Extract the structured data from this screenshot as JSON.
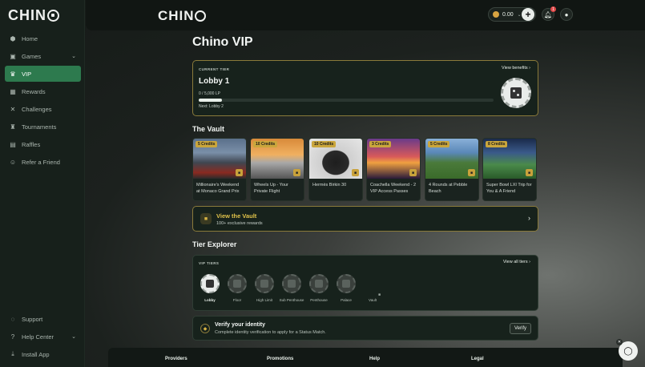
{
  "brand": {
    "logo": "CHINO"
  },
  "sidebar": {
    "items": [
      {
        "label": "Home",
        "icon": "home-icon"
      },
      {
        "label": "Games",
        "icon": "gamepad-icon"
      },
      {
        "label": "VIP",
        "icon": "crown-icon"
      },
      {
        "label": "Rewards",
        "icon": "gift-icon"
      },
      {
        "label": "Challenges",
        "icon": "swords-icon"
      },
      {
        "label": "Tournaments",
        "icon": "trophy-icon"
      },
      {
        "label": "Raffles",
        "icon": "ticket-icon"
      },
      {
        "label": "Refer a Friend",
        "icon": "user-plus-icon"
      }
    ],
    "bottom": [
      {
        "label": "Support",
        "icon": "chat-icon"
      },
      {
        "label": "Help Center",
        "icon": "question-icon"
      },
      {
        "label": "Install App",
        "icon": "download-icon"
      }
    ]
  },
  "topbar": {
    "balance": "0.00",
    "notifications": "1"
  },
  "page": {
    "title": "Chino VIP"
  },
  "current_tier": {
    "label": "CURRENT TIER",
    "name": "Lobby 1",
    "progress_text": "0 / 5,000 LP",
    "progress": 0.08,
    "next": "Next: Lobby 2",
    "benefits_link": "View benefits"
  },
  "vault": {
    "title": "The Vault",
    "items": [
      {
        "credits": "5 Credits",
        "title": "Millionaire's Weekend at Monaco Grand Prix"
      },
      {
        "credits": "10 Credits",
        "title": "Wheels Up - Your Private Flight"
      },
      {
        "credits": "10 Credits",
        "title": "Hermès Birkin 30"
      },
      {
        "credits": "3 Credits",
        "title": "Coachella Weekend - 2 VIP Access Passes"
      },
      {
        "credits": "5 Credits",
        "title": "4 Rounds at Pebble Beach"
      },
      {
        "credits": "8 Credits",
        "title": "Super Bowl LXI Trip for You & A Friend"
      }
    ],
    "cta_title": "View the Vault",
    "cta_sub": "100+ exclusive rewards"
  },
  "tiers": {
    "title": "Tier Explorer",
    "label": "VIP TIERS",
    "view_all": "View all tiers",
    "names": [
      "Lobby",
      "Floor",
      "High Limit",
      "Sub Penthouse",
      "Penthouse",
      "Palace",
      "Vault"
    ]
  },
  "verify": {
    "title": "Verify your identity",
    "sub": "Complete identity verification to apply for a Status Match.",
    "button": "Verify"
  },
  "footer": [
    "Providers",
    "Promotions",
    "Help",
    "Legal"
  ]
}
